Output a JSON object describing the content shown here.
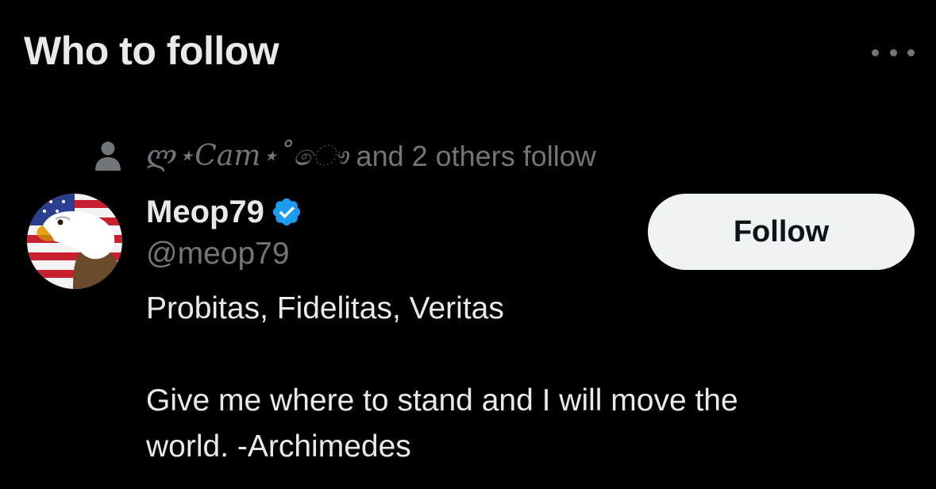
{
  "section": {
    "title": "Who to follow",
    "more_icon": "more-horizontal-icon"
  },
  "social_context": {
    "icon": "person-icon",
    "follower_name": "ლ⋆Cam⋆˚ෞ",
    "suffix": "and 2 others follow"
  },
  "user": {
    "display_name": "Meop79",
    "verified_icon": "verified-badge-icon",
    "verified_color": "#1d9bf0",
    "handle": "@meop79",
    "bio_line_1": "Probitas, Fidelitas, Veritas",
    "bio_line_2": "Give me where to stand and I will move the",
    "bio_line_3": "world. -Archimedes",
    "avatar": "bald-eagle-american-flag-avatar"
  },
  "follow_button": {
    "label": "Follow"
  },
  "colors": {
    "background": "#000000",
    "primary_text": "#e7e9ea",
    "secondary_text": "#71767b",
    "button_bg": "#eff3f4",
    "button_text": "#0f1419"
  }
}
